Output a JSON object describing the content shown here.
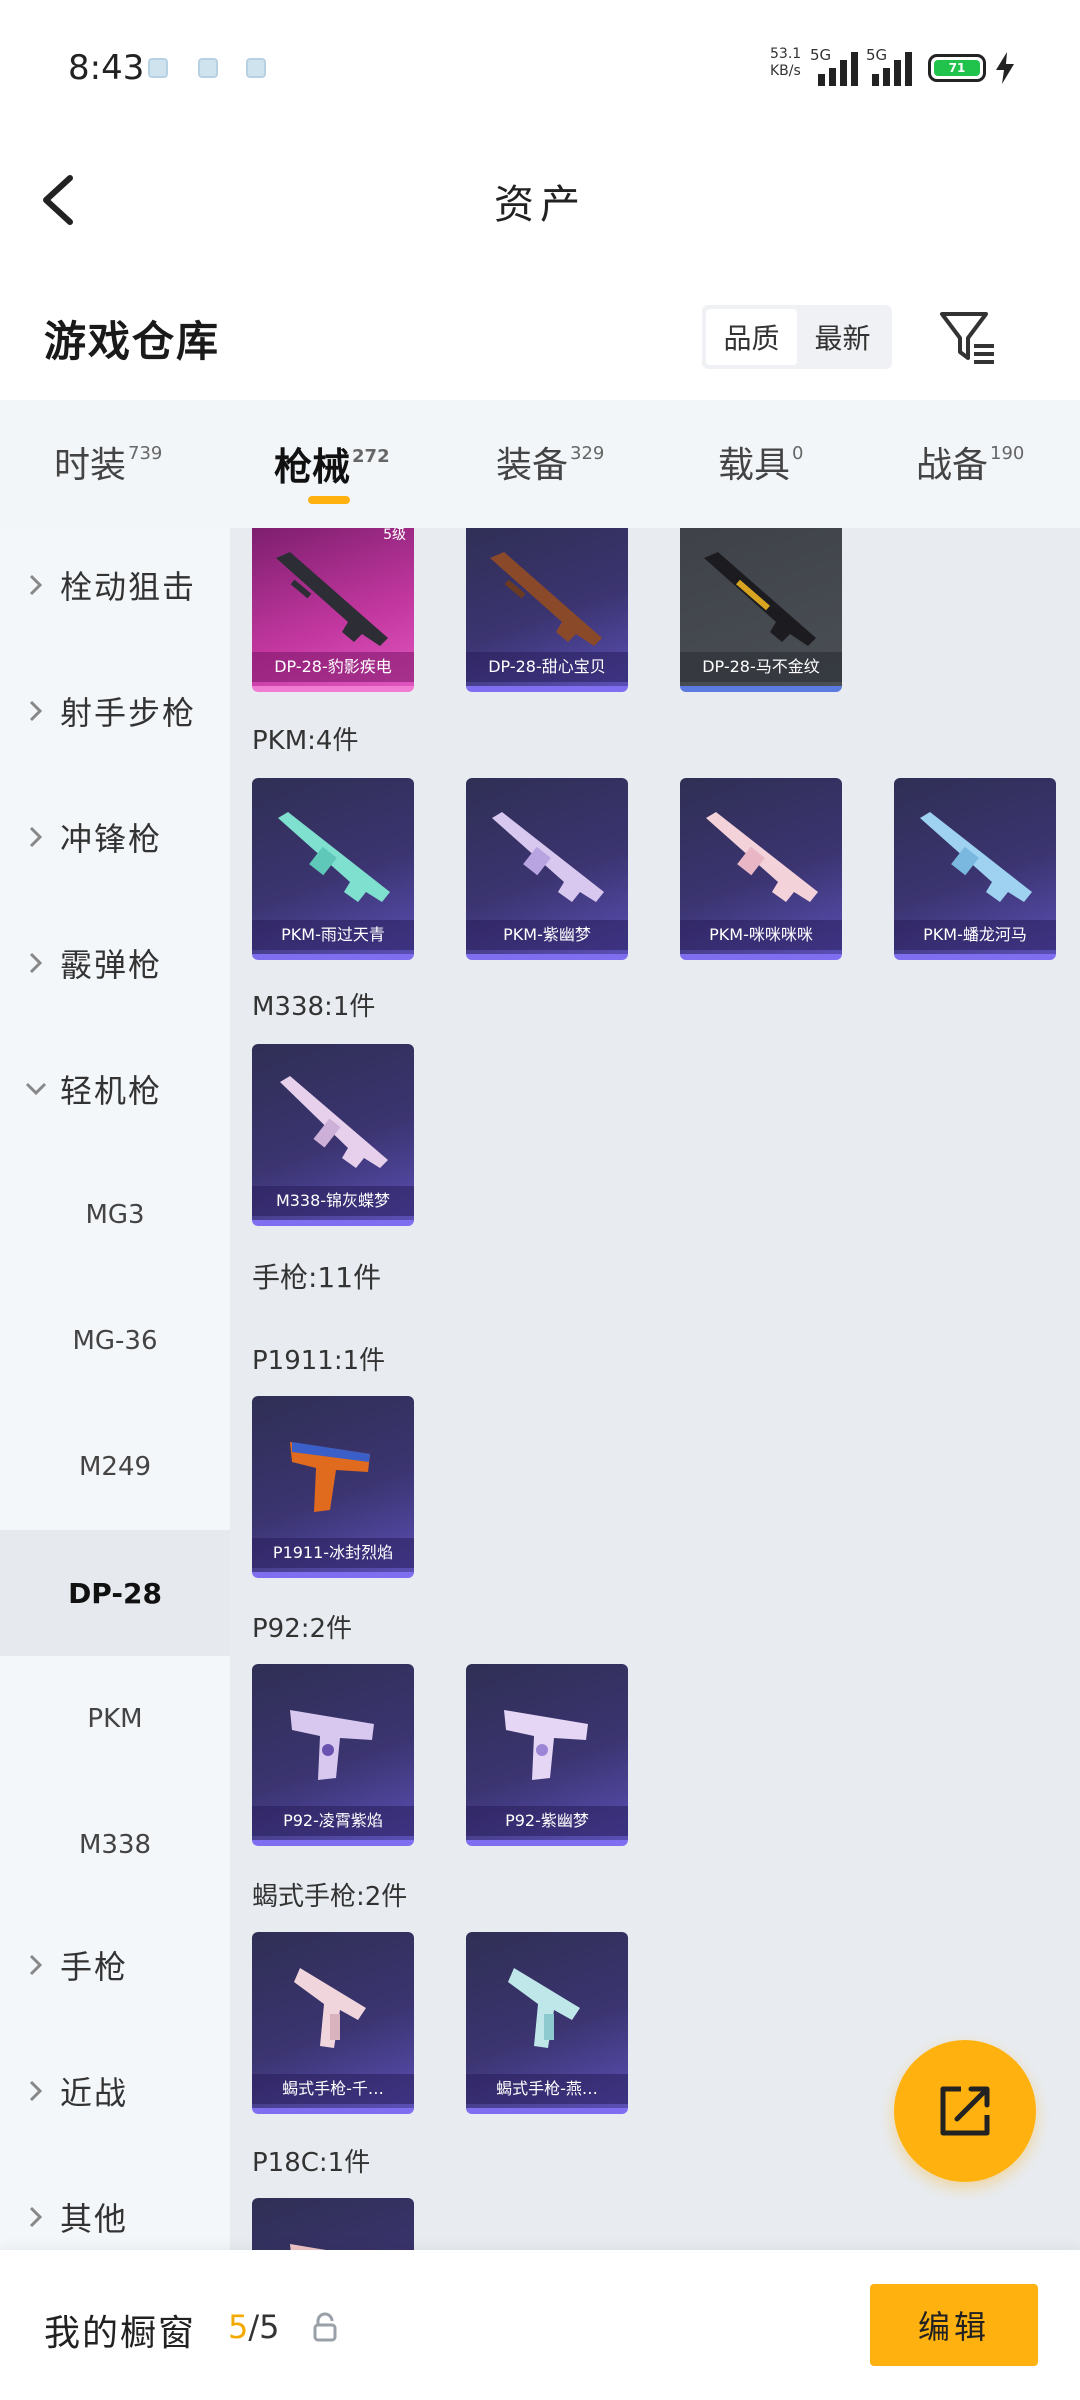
{
  "status_bar": {
    "time": "8:43",
    "net_speed_value": "53.1",
    "net_speed_unit": "KB/s",
    "sim1": "5G",
    "sim2": "5G",
    "battery": "71",
    "colors": {
      "battery": "#22c34d"
    }
  },
  "header": {
    "title": "资产",
    "back_icon": "chevron-left-icon"
  },
  "section": {
    "title": "游戏仓库",
    "sort_options": [
      "品质",
      "最新"
    ],
    "sort_selected": "品质",
    "filter_icon": "filter-icon"
  },
  "tabs": [
    {
      "label": "时装",
      "count": "739",
      "active": false
    },
    {
      "label": "枪械",
      "count": "272",
      "active": true
    },
    {
      "label": "装备",
      "count": "329",
      "active": false
    },
    {
      "label": "载具",
      "count": "0",
      "active": false
    },
    {
      "label": "战备",
      "count": "190",
      "active": false
    }
  ],
  "sidebar": {
    "categories": [
      {
        "label": "栓动狙击",
        "expanded": false
      },
      {
        "label": "射手步枪",
        "expanded": false
      },
      {
        "label": "冲锋枪",
        "expanded": false
      },
      {
        "label": "霰弹枪",
        "expanded": false
      },
      {
        "label": "轻机枪",
        "expanded": true
      },
      {
        "label": "手枪",
        "expanded": false
      },
      {
        "label": "近战",
        "expanded": false
      },
      {
        "label": "其他",
        "expanded": false
      }
    ],
    "sub_items": [
      "MG3",
      "MG-36",
      "M249",
      "DP-28",
      "PKM",
      "M338"
    ],
    "selected_sub": "DP-28"
  },
  "content": {
    "dp28_cards": [
      {
        "name": "DP-28-豹影疾电",
        "tag": "5级",
        "rarity": "legendary"
      },
      {
        "name": "DP-28-甜心宝贝",
        "tag": "",
        "rarity": "epic"
      },
      {
        "name": "DP-28-马不金纹",
        "tag": "",
        "rarity": "gray"
      }
    ],
    "groups": [
      {
        "label": "PKM:4件",
        "cards": [
          "PKM-雨过天青",
          "PKM-紫幽梦",
          "PKM-咪咪咪咪",
          "PKM-蟠龙河马"
        ]
      },
      {
        "label": "M338:1件",
        "cards": [
          "M338-锦灰蝶梦"
        ]
      },
      {
        "label": "手枪:11件",
        "cards": []
      },
      {
        "label": "P1911:1件",
        "cards": [
          "P1911-冰封烈焰"
        ]
      },
      {
        "label": "P92:2件",
        "cards": [
          "P92-凌霄紫焰",
          "P92-紫幽梦"
        ]
      },
      {
        "label": "蝎式手枪:2件",
        "cards": [
          "蝎式手枪-千…",
          "蝎式手枪-燕…"
        ]
      },
      {
        "label": "P18C:1件",
        "cards": []
      }
    ],
    "colors": {
      "accent": "#ffb20f",
      "legendary": "#c2379f",
      "epic": "#3b3470"
    }
  },
  "fab": {
    "icon": "share-icon"
  },
  "bottom_bar": {
    "label": "我的橱窗",
    "count_current": "5",
    "count_total": "/5",
    "lock_icon": "lock-icon",
    "edit_label": "编辑"
  }
}
